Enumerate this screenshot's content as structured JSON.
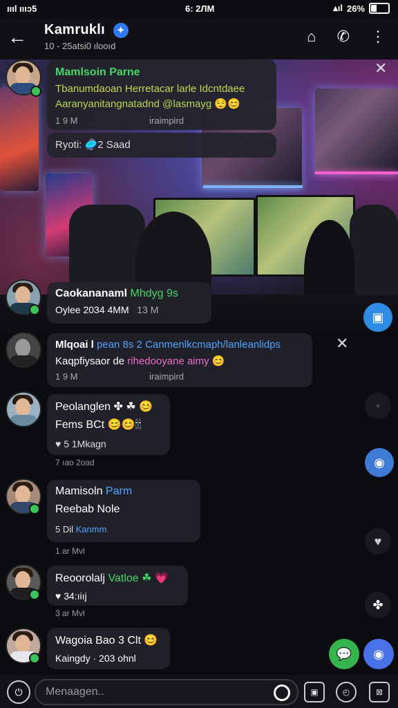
{
  "status_bar": {
    "carrier": "ıııl ıııɔ5",
    "time": "6: 2ЛM",
    "battery": "26%"
  },
  "header": {
    "title": "Kamruklı",
    "subtitle": "10 - 25atsi0 ılooıd",
    "back_label": "←",
    "icons": [
      "add-contact-icon",
      "call-icon",
      "more-icon"
    ]
  },
  "pinned": {
    "name": "Mamlsoin Parne",
    "line1": "Tbanumdaoan Herretacar larle Idcntdaee",
    "line2": "Aaranyanitangnatadnd @lasmayg 😌😊",
    "left_meta": "1 9 M",
    "right_meta": "iraimpird",
    "reply": "Ryoti: 🥏2 Saad"
  },
  "messages": [
    {
      "name": "Caokananaml",
      "name_extra": "Mhdyg 9s",
      "line": "Oylee 2034 4MM",
      "line_extra": "13 M"
    },
    {
      "name": "Mlqoai l",
      "name_extra": "pean 8s 2 Canmenlkcmaph/lanleanlidps",
      "line": "Kaqpfiysaor de ",
      "line_extra": "rihedooyane aimy 😊",
      "left_meta": "1 9 M",
      "right_meta": "iraimpird"
    },
    {
      "name": "Peolanglen",
      "name_extra": "✤ ☘ 😊",
      "line": "Fems BCt 😊😊🕯🕯",
      "react": "♥ 5 1Mkagn",
      "time": "7 ıao 2oad"
    },
    {
      "name": "Mamisoln",
      "name_extra": "Parm",
      "line": "Reebab Nole",
      "react": "5 Dil",
      "react_extra": "Kanmm",
      "time": "1 ar Mvl"
    },
    {
      "name": "Reoorolalj",
      "name_extra": "Vatloe ☘ 💗",
      "line": "♥ 34:ıiıj",
      "time": "3 ar Mvl"
    },
    {
      "name": "Wagoia Bao 3",
      "name_extra": "Clt 😊",
      "line": "Kaingdy · 203 ohnl"
    }
  ],
  "input": {
    "placeholder": "Menaagen.."
  }
}
